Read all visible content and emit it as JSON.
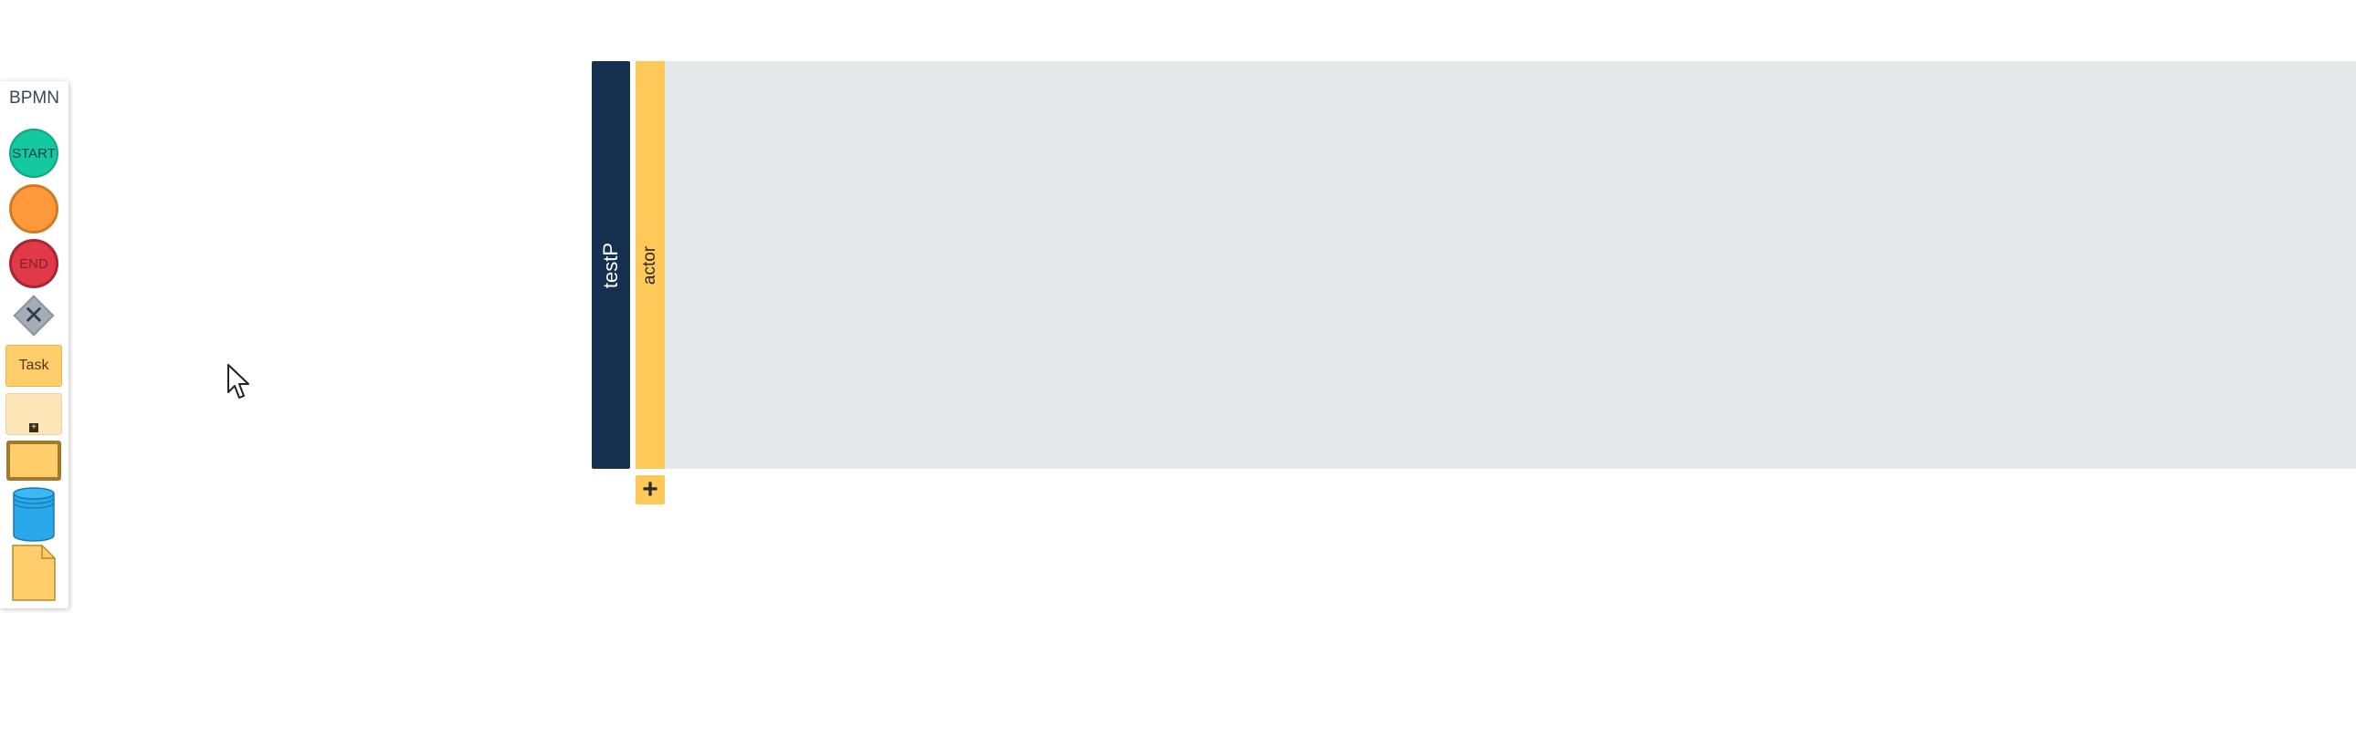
{
  "palette": {
    "title": "BPMN",
    "start_label": "START",
    "end_label": "END",
    "task_label": "Task",
    "gateway_symbol": "✕",
    "subprocess_marker": "+",
    "icons": {
      "start_event": "start-event-icon",
      "intermediate_event": "intermediate-event-icon",
      "end_event": "end-event-icon",
      "gateway": "exclusive-gateway-icon",
      "task": "task-icon",
      "subprocess": "subprocess-icon",
      "call_activity": "call-activity-icon",
      "data_store": "data-store-icon",
      "data_object": "data-object-icon"
    }
  },
  "pool": {
    "title": "testP",
    "lanes": [
      {
        "label": "actor"
      }
    ],
    "add_lane_label": "+"
  },
  "colors": {
    "pool_header": "#15314f",
    "lane_header": "#ffc95a",
    "lane_body": "#e5e9ec",
    "start": "#14c8a0",
    "intermediate": "#ff9a3c",
    "end": "#e03a4a",
    "gateway": "#a4acb6",
    "task": "#ffce6a",
    "data_store": "#2aa9ea"
  }
}
